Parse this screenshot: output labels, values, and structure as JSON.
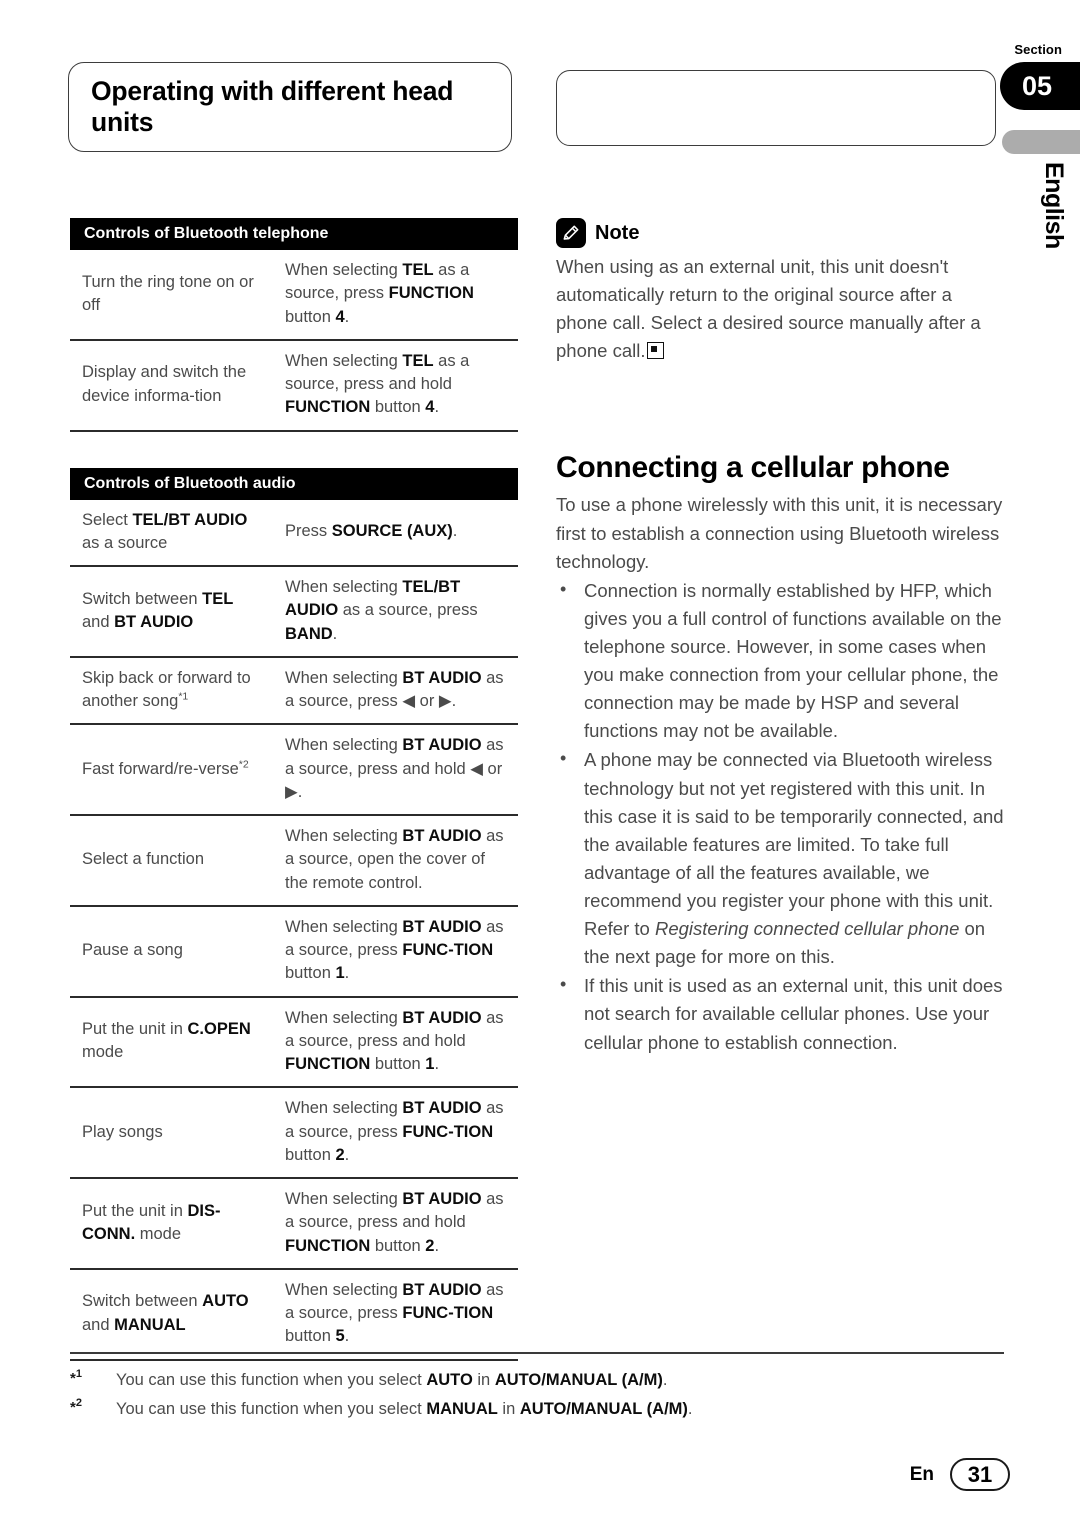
{
  "header": {
    "title": "Operating with different head units",
    "blank_box": "",
    "section_label": "Section",
    "section_number": "05",
    "language": "English"
  },
  "tables": [
    {
      "heading": "Controls of Bluetooth telephone",
      "rows": [
        {
          "action_html": "Turn the ring tone on or off",
          "operation_html": "When selecting <b>TEL</b> as a source, press <b>FUNCTION</b> button <b>4</b>."
        },
        {
          "action_html": "Display and switch the device informa-tion",
          "operation_html": "When selecting <b>TEL</b> as a source, press and hold <b>FUNCTION</b> button <b>4</b>."
        }
      ]
    },
    {
      "heading": "Controls of Bluetooth audio",
      "rows": [
        {
          "action_html": "Select <b>TEL/BT AUDIO</b> as a source",
          "operation_html": "Press <b>SOURCE (AUX)</b>."
        },
        {
          "action_html": "Switch between <b>TEL</b> and <b>BT AUDIO</b>",
          "operation_html": "When selecting <b>TEL/BT AUDIO</b> as a source, press <b>BAND</b>."
        },
        {
          "action_html": "Skip back or forward to another song<sup class=\"fn\">*1</sup>",
          "operation_html": "When selecting <b>BT AUDIO</b> as a source, press ◀ or ▶."
        },
        {
          "action_html": "Fast forward/re-verse<sup class=\"fn\">*2</sup>",
          "operation_html": "When selecting <b>BT AUDIO</b> as a source, press and hold ◀ or ▶."
        },
        {
          "action_html": "Select a function",
          "operation_html": "When selecting <b>BT AUDIO</b> as a source, open the cover of the remote control."
        },
        {
          "action_html": "Pause a song",
          "operation_html": "When selecting <b>BT AUDIO</b> as a source, press <b>FUNC-TION</b> button <b>1</b>."
        },
        {
          "action_html": "Put the unit in <b>C.OPEN</b> mode",
          "operation_html": "When selecting <b>BT AUDIO</b> as a source, press and hold <b>FUNCTION</b> button <b>1</b>."
        },
        {
          "action_html": "Play songs",
          "operation_html": "When selecting <b>BT AUDIO</b> as a source, press <b>FUNC-TION</b> button <b>2</b>."
        },
        {
          "action_html": "Put the unit in <b>DIS-CONN.</b> mode",
          "operation_html": "When selecting <b>BT AUDIO</b> as a source, press and hold <b>FUNCTION</b> button <b>2</b>."
        },
        {
          "action_html": "Switch between <b>AUTO</b> and <b>MANUAL</b>",
          "operation_html": "When selecting <b>BT AUDIO</b> as a source, press <b>FUNC-TION</b> button <b>5</b>."
        }
      ]
    }
  ],
  "note": {
    "icon": "pencil-icon",
    "title": "Note",
    "body": "When using as an external unit, this unit doesn't automatically return to the original source after a phone call. Select a desired source manually after a phone call."
  },
  "section": {
    "heading": "Connecting a cellular phone",
    "intro": "To use a phone wirelessly with this unit, it is necessary first to establish a connection using Bluetooth wireless technology.",
    "bullets": [
      {
        "html": "Connection is normally established by HFP, which gives you a full control of functions available on the telephone source. However, in some cases when you make connection from your cellular phone, the connection may be made by HSP and several functions may not be available."
      },
      {
        "html": "A phone may be connected via Bluetooth wireless technology but not yet registered with this unit. In this case it is said to be temporarily connected, and the available features are limited. To take full advantage of all the features available, we recommend you register your phone with this unit. Refer to <i>Registering connected cellular phone</i> on the next page for more on this."
      },
      {
        "html": "If this unit is used as an external unit, this unit does not search for available cellular phones. Use your cellular phone to establish connection."
      }
    ]
  },
  "footnotes": [
    {
      "mark_html": "*<sup>1</sup>",
      "text_html": "You can use this function when you select <b>AUTO</b> in <b>AUTO/MANUAL (A/M)</b>."
    },
    {
      "mark_html": "*<sup>2</sup>",
      "text_html": "You can use this function when you select <b>MANUAL</b> in <b>AUTO/MANUAL (A/M)</b>."
    }
  ],
  "footer": {
    "language_code": "En",
    "page_number": "31"
  }
}
